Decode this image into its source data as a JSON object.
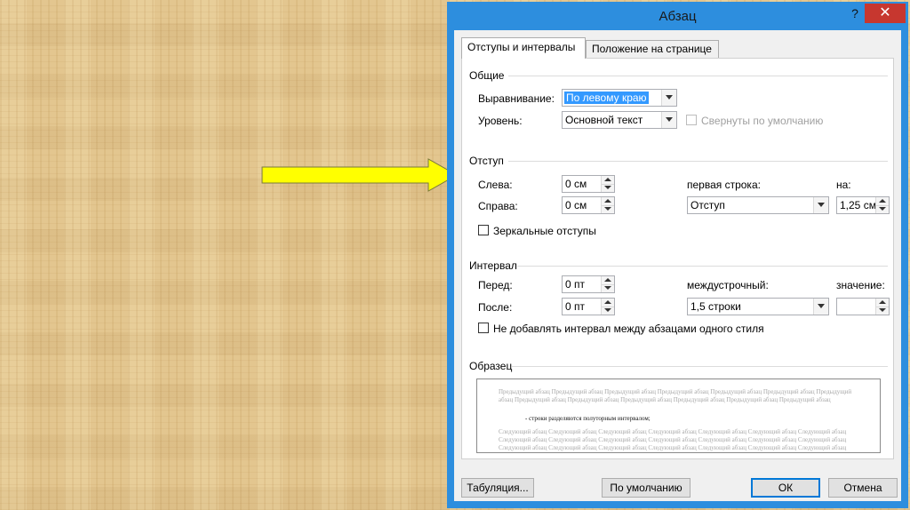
{
  "window": {
    "title": "Абзац",
    "help": "?",
    "close": "✕"
  },
  "tabs": [
    {
      "label": "Отступы и интервалы",
      "active": true
    },
    {
      "label": "Положение на странице",
      "active": false
    }
  ],
  "general": {
    "heading": "Общие",
    "alignment_label": "Выравнивание:",
    "alignment_value": "По левому краю",
    "level_label": "Уровень:",
    "level_value": "Основной текст",
    "collapsed_label": "Свернуты по умолчанию"
  },
  "indent": {
    "heading": "Отступ",
    "left_label": "Слева:",
    "left_value": "0 см",
    "right_label": "Справа:",
    "right_value": "0 см",
    "first_line_label": "первая строка:",
    "first_line_value": "Отступ",
    "by_label": "на:",
    "by_value": "1,25 см",
    "mirror_label": "Зеркальные отступы"
  },
  "spacing": {
    "heading": "Интервал",
    "before_label": "Перед:",
    "before_value": "0 пт",
    "after_label": "После:",
    "after_value": "0 пт",
    "line_label": "междустрочный:",
    "line_value": "1,5 строки",
    "value_label": "значение:",
    "value_value": "",
    "no_space_label": "Не добавлять интервал между абзацами одного стиля"
  },
  "preview": {
    "heading": "Образец",
    "prev_text": "Предыдущий абзац Предыдущий абзац Предыдущий абзац Предыдущий абзац Предыдущий абзац Предыдущий абзац Предыдущий абзац Предыдущий абзац Предыдущий абзац Предыдущий абзац Предыдущий абзац Предыдущий абзац Предыдущий абзац",
    "current_text": "- строки разделяются полуторным интервалом;",
    "next_text": "Следующий абзац Следующий абзац Следующий абзац Следующий абзац Следующий абзац Следующий абзац Следующий абзац Следующий абзац Следующий абзац Следующий абзац Следующий абзац Следующий абзац Следующий абзац Следующий абзац Следующий абзац Следующий абзац Следующий абзац Следующий абзац Следующий абзац Следующий абзац Следующий абзац Следующий абзац Следующий абзац Следующий абзац Следующий абзац Следующий абзац Следующий абзац Следующий абзац Следующий абзац Следующий абзац Следующий абзац Следующий абзац"
  },
  "buttons": {
    "tabs": "Табуляция...",
    "default": "По умолчанию",
    "ok": "ОК",
    "cancel": "Отмена"
  },
  "colors": {
    "title_bar": "#2d8ede",
    "close_button": "#c7372f",
    "arrow_fill": "#ffff00",
    "selection": "#3399ff"
  }
}
